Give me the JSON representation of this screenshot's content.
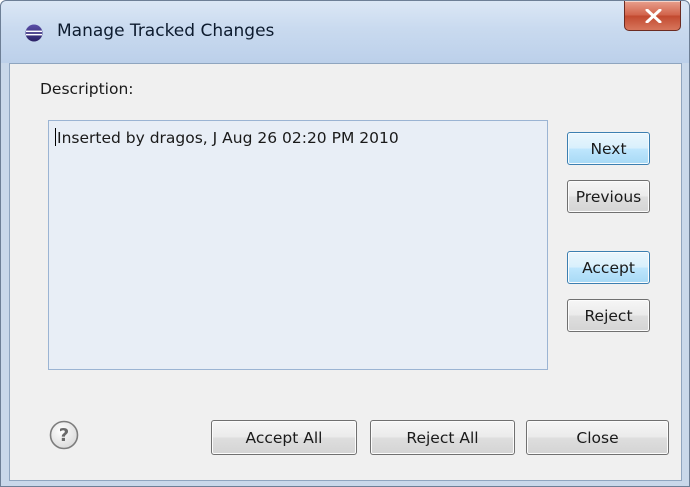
{
  "window": {
    "title": "Manage Tracked Changes"
  },
  "dialog": {
    "description_label": "Description:",
    "description_text": "Inserted by dragos, J Aug 26 02:20 PM 2010"
  },
  "side_buttons": {
    "next": "Next",
    "previous": "Previous",
    "accept": "Accept",
    "reject": "Reject"
  },
  "footer_buttons": {
    "accept_all": "Accept All",
    "reject_all": "Reject All",
    "close": "Close"
  },
  "icons": {
    "app": "eclipse-icon",
    "close": "close-icon",
    "help": "help-icon"
  },
  "colors": {
    "title_close": "#c9503a",
    "content_bg": "#f0f0f0",
    "text_area_bg": "#e8eef6",
    "default_button": "#bee6fd"
  }
}
